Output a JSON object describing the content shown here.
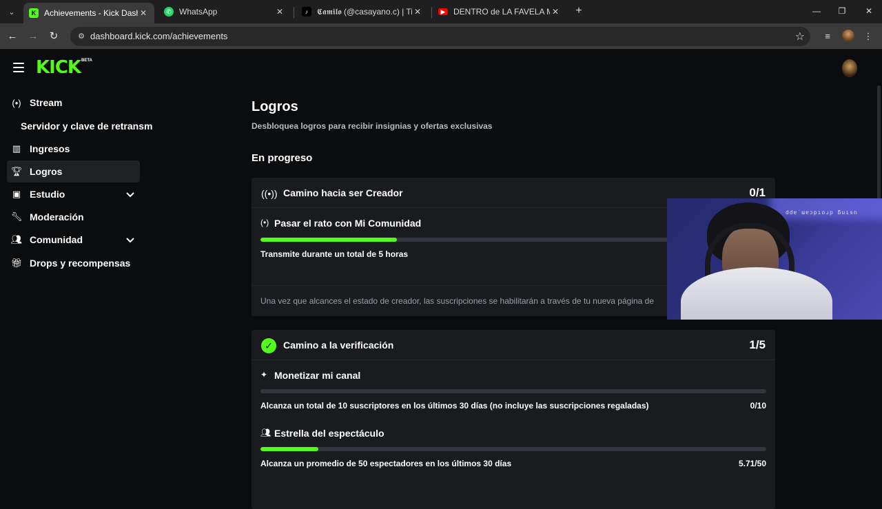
{
  "browser": {
    "tabs": [
      {
        "title": "Achievements - Kick Dashboard",
        "active": true,
        "icon": "kick-icon",
        "icon_color": "#53fc18"
      },
      {
        "title": "WhatsApp",
        "active": false,
        "icon": "whatsapp-icon",
        "icon_color": "#25d366"
      },
      {
        "title": "𝕮𝖆𝖒𝖎𝖑𝖔 (@casayano.c) | TikTok",
        "active": false,
        "icon": "tiktok-icon",
        "icon_color": "#000000"
      },
      {
        "title": "DENTRO de LA FAVELA MÁS GR",
        "active": false,
        "icon": "youtube-icon",
        "icon_color": "#ff0000"
      }
    ],
    "url": "dashboard.kick.com/achievements"
  },
  "app": {
    "logo": "KICK",
    "logo_badge": "BETA",
    "accent_color": "#53fc18"
  },
  "sidebar": {
    "items": [
      {
        "label": "Stream",
        "icon": "broadcast-icon"
      },
      {
        "label": "Servidor y clave de retransm",
        "sub": true
      },
      {
        "label": "Ingresos",
        "icon": "chart-icon"
      },
      {
        "label": "Logros",
        "icon": "trophy-icon",
        "active": true
      },
      {
        "label": "Estudio",
        "icon": "studio-icon",
        "expandable": true
      },
      {
        "label": "Moderación",
        "icon": "wrench-icon"
      },
      {
        "label": "Comunidad",
        "icon": "users-icon",
        "expandable": true
      },
      {
        "label": "Drops y recompensas",
        "icon": "gift-icon"
      }
    ]
  },
  "main": {
    "title": "Logros",
    "subtitle": "Desbloquea logros para recibir insignias y ofertas exclusivas",
    "section": "En progreso",
    "cards": [
      {
        "title": "Camino hacia ser Creador",
        "count": "0/1",
        "icon": "broadcast-icon",
        "tasks": [
          {
            "name": "Pasar el rato con Mi Comunidad",
            "icon": "broadcast-icon",
            "description": "Transmite durante un total de 5 horas",
            "progress": 0.27,
            "progress_text": ""
          }
        ],
        "note": "Una vez que alcances el estado de creador, las suscripciones se habilitarán a través de tu nueva página de"
      },
      {
        "title": "Camino a la verificación",
        "count": "1/5",
        "icon": "verified-icon",
        "tasks": [
          {
            "name": "Monetizar mi canal",
            "icon": "sparkle-icon",
            "description": "Alcanza un total de 10 suscriptores en los últimos 30 días (no incluye las suscripciones regaladas)",
            "progress": 0.0,
            "progress_text": "0/10"
          },
          {
            "name": "Estrella del espectáculo",
            "icon": "viewers-icon",
            "description": "Alcanza un promedio de 50 espectadores en los últimos 30 días",
            "progress": 0.1142,
            "progress_text": "5.71/50"
          }
        ]
      }
    ]
  },
  "webcam": {
    "overlay_text": "ddɐ˙ɯɐɔpıoɹp ƃuısn"
  }
}
